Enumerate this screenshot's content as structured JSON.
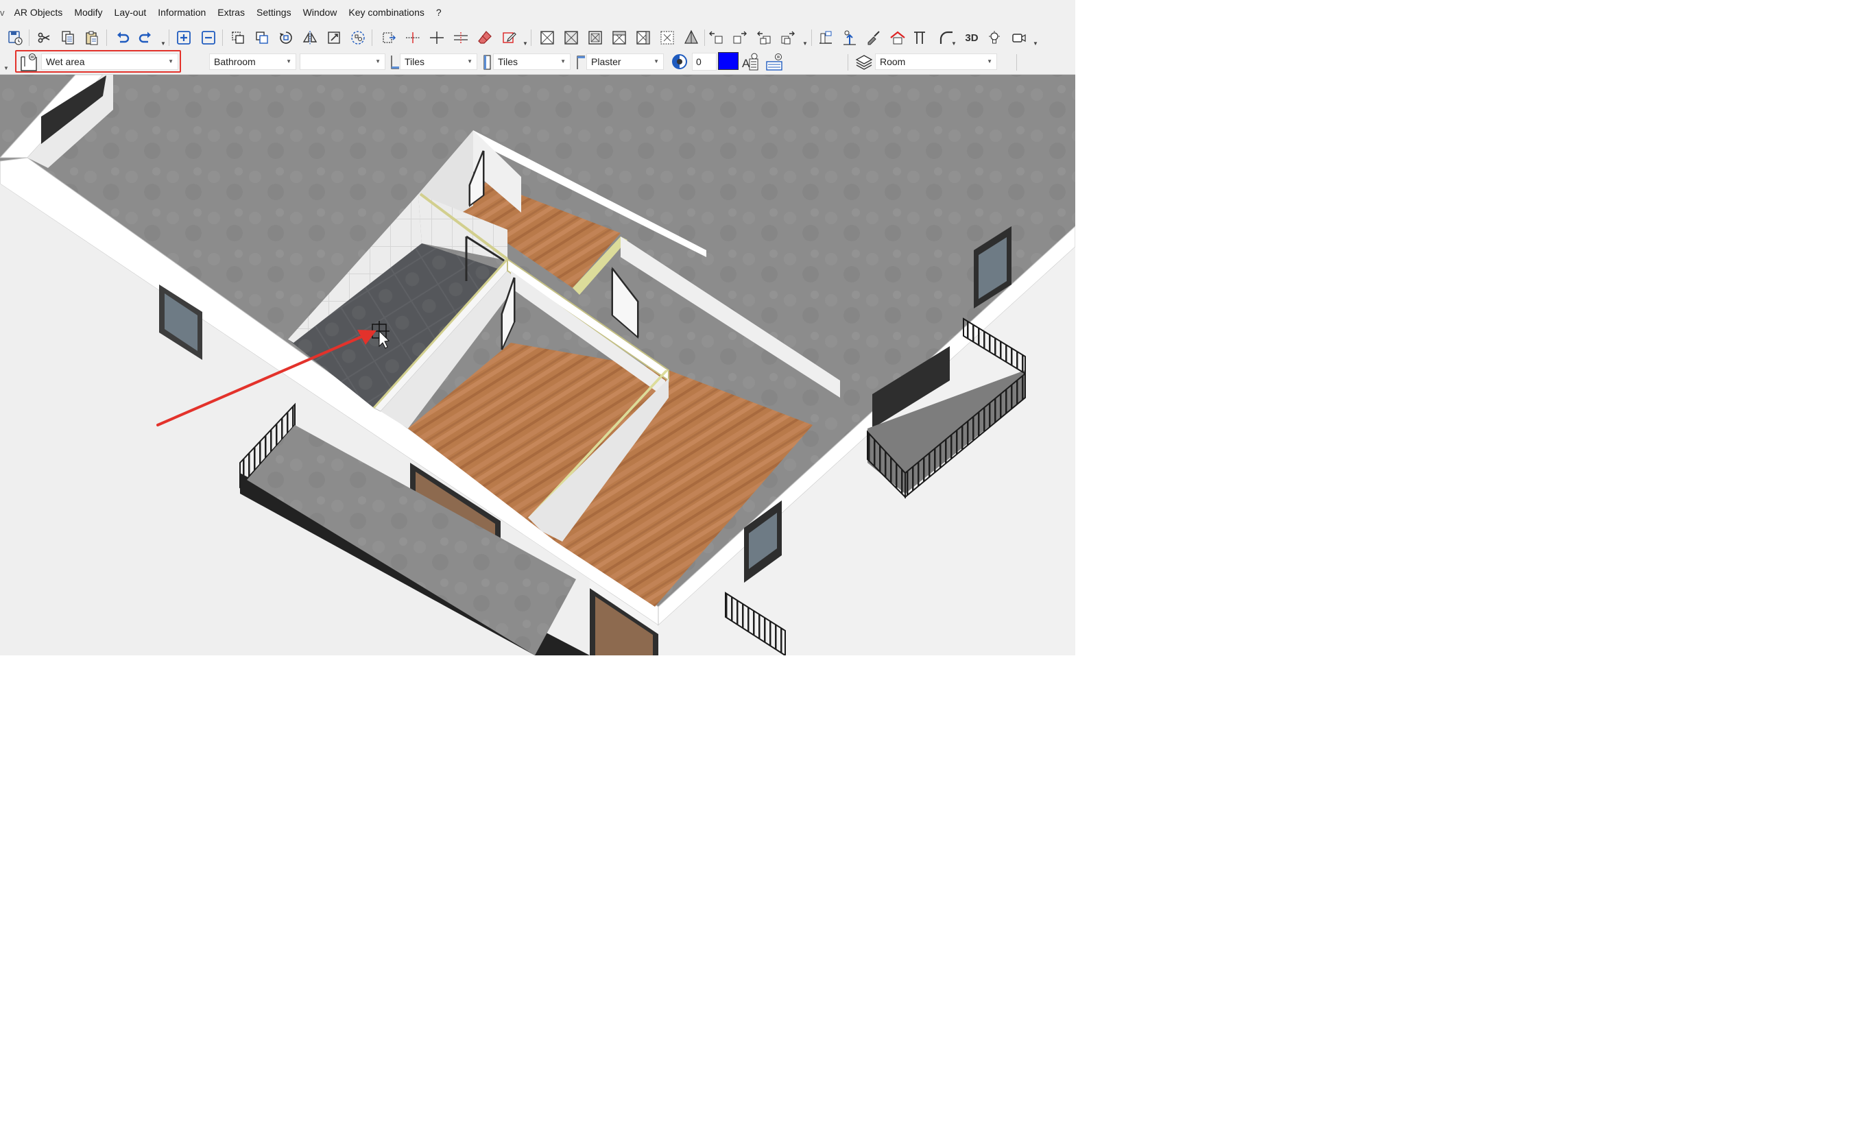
{
  "menu": {
    "stub": "v",
    "items": [
      "AR Objects",
      "Modify",
      "Lay-out",
      "Information",
      "Extras",
      "Settings",
      "Window",
      "Key combinations",
      "?"
    ]
  },
  "toolbar": {
    "three_d_label": "3D"
  },
  "properties": {
    "object_type": "Wet area",
    "room_function": "Bathroom",
    "secondary": "",
    "floor_finish": "Tiles",
    "wall_finish": "Tiles",
    "ceiling_finish": "Plaster",
    "pen_number": "0",
    "color": "#0000ff",
    "layer": "Room"
  },
  "annotation": {
    "highlight_color": "#e3322b",
    "arrow_color": "#e3322b"
  },
  "colors": {
    "roof_gray": "#8a8a8a",
    "wood_floor": "#b9784a",
    "tile_floor": "#5a5c60",
    "wall_white": "#f2f2f2"
  }
}
